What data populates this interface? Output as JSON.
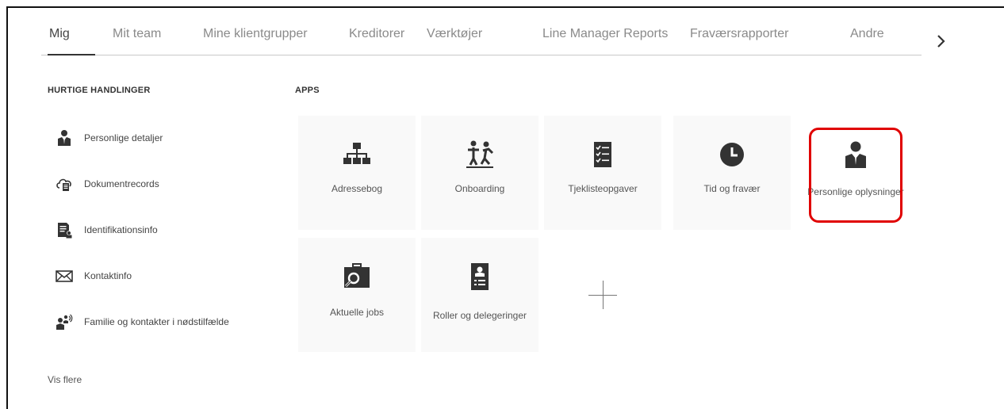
{
  "tabs": [
    {
      "label": "Mig",
      "active": true
    },
    {
      "label": "Mit team",
      "active": false
    },
    {
      "label": "Mine klientgrupper",
      "active": false
    },
    {
      "label": "Kreditorer",
      "active": false
    },
    {
      "label": "Værktøjer",
      "active": false
    },
    {
      "label": "Line Manager Reports",
      "active": false
    },
    {
      "label": "Fraværsrapporter",
      "active": false
    },
    {
      "label": "Andre",
      "active": false
    }
  ],
  "quick_actions": {
    "heading": "HURTIGE HANDLINGER",
    "items": [
      {
        "label": "Personlige detaljer",
        "icon": "person-icon"
      },
      {
        "label": "Dokumentrecords",
        "icon": "cloud-document-icon"
      },
      {
        "label": "Identifikationsinfo",
        "icon": "id-document-icon"
      },
      {
        "label": "Kontaktinfo",
        "icon": "envelope-icon"
      },
      {
        "label": "Familie og kontakter i nødstilfælde",
        "icon": "family-contacts-icon"
      }
    ],
    "more_label": "Vis flere"
  },
  "apps": {
    "heading": "APPS",
    "tiles": [
      {
        "label": "Adressebog",
        "icon": "org-chart-icon"
      },
      {
        "label": "Onboarding",
        "icon": "onboarding-people-icon"
      },
      {
        "label": "Tjeklisteopgaver",
        "icon": "checklist-icon"
      },
      {
        "label": "Tid og fravær",
        "icon": "clock-icon"
      },
      {
        "label": "Personlige oplysninger",
        "icon": "person-icon"
      },
      {
        "label": "Aktuelle jobs",
        "icon": "job-search-icon"
      },
      {
        "label": "Roller og delegeringer",
        "icon": "id-badge-icon"
      }
    ],
    "highlight_color": "#e00000"
  }
}
